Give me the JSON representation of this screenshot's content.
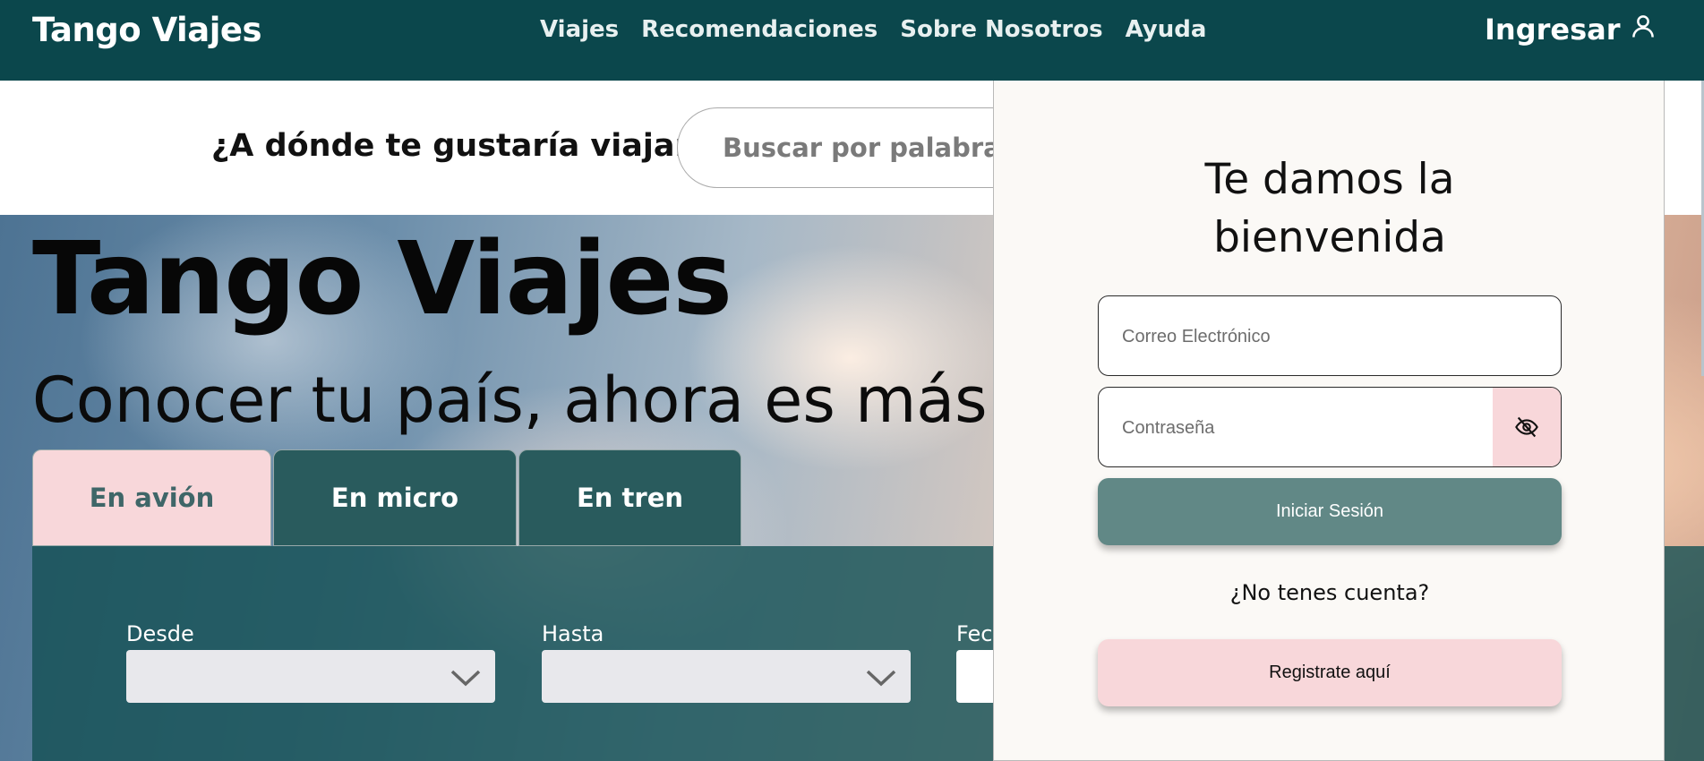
{
  "navbar": {
    "brand": "Tango Viajes",
    "links": [
      "Viajes",
      "Recomendaciones",
      "Sobre Nosotros",
      "Ayuda"
    ],
    "login_label": "Ingresar",
    "login_icon": "user-icon",
    "background": "#0b474c"
  },
  "search": {
    "question": "¿A dónde te gustaría viajar?",
    "placeholder": "Buscar por palabra, e"
  },
  "hero": {
    "title": "Tango Viajes",
    "subtitle": "Conocer tu país, ahora es más fá",
    "tabs": [
      {
        "label": "En avión",
        "active": true
      },
      {
        "label": "En micro",
        "active": false
      },
      {
        "label": "En tren",
        "active": false
      }
    ],
    "form": {
      "from_label": "Desde",
      "to_label": "Hasta",
      "date_label": "Fecl"
    }
  },
  "login_panel": {
    "welcome_line1": "Te damos la",
    "welcome_line2": "bienvenida",
    "email_placeholder": "Correo Electrónico",
    "password_placeholder": "Contraseña",
    "toggle_icon": "eye-off-icon",
    "submit_label": "Iniciar Sesión",
    "no_account": "¿No tenes cuenta?",
    "register_label": "Registrate aquí"
  },
  "colors": {
    "primary_dark": "#0b474c",
    "tab_inactive": "#295b5d",
    "accent_pink": "#f8d7da",
    "button_teal": "#618886"
  }
}
